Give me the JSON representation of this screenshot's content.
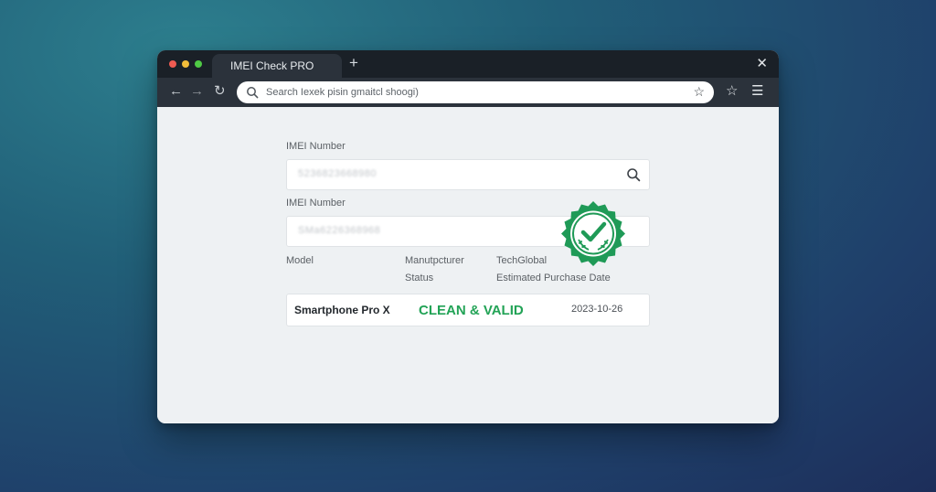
{
  "browser": {
    "tab_title": "IMEI Check PRO",
    "new_tab_glyph": "+",
    "close_glyph": "✕",
    "address_text": "Search Iexek pisin gmaitcl shoogi)",
    "nav": {
      "back": "←",
      "forward": "→",
      "reload": "↻"
    },
    "omnibox_star": "☆",
    "toolbar_star": "☆",
    "menu_glyph": "☰"
  },
  "form": {
    "field1_label": "IMEI Number",
    "field1_value": "5236823668980",
    "field2_label": "IMEI Number",
    "field2_value": "SMa6226368968",
    "col_model": "Model",
    "col_manufacturer": "Manutpcturer",
    "col_status": "Status",
    "col_techglobal": "TechGlobal",
    "col_purchase_date": "Estimated Purchase Date"
  },
  "result": {
    "model": "Smartphone Pro X",
    "status": "CLEAN & VALID",
    "date": "2023-10-26"
  },
  "colors": {
    "accent_green": "#22a356",
    "badge_green": "#1f9a57",
    "titlebar": "#1a2027",
    "toolbar": "#2b323b"
  },
  "icons": {
    "badge": "verified-check-badge-icon",
    "search": "search-icon"
  }
}
